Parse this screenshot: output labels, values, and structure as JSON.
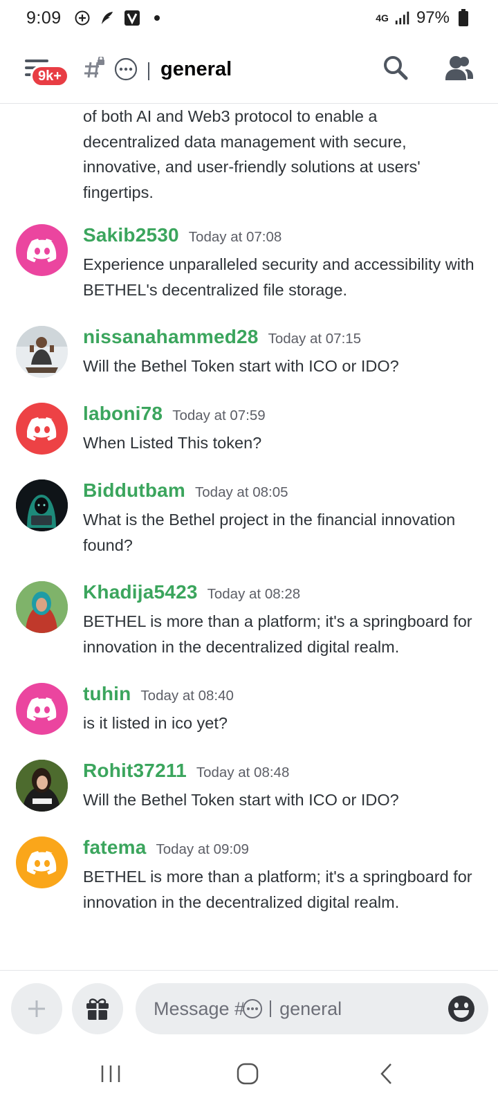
{
  "status_bar": {
    "time": "9:09",
    "network": "4G",
    "battery": "97%"
  },
  "header": {
    "badge": "9k+",
    "channel_name": "general"
  },
  "messages": {
    "continuation": "of both AI and Web3 protocol to enable a decentralized data management with secure, innovative, and user-friendly solutions at users' fingertips.",
    "items": [
      {
        "username": "Sakib2530",
        "timestamp": "Today at 07:08",
        "text": "Experience unparalleled security and accessibility with BETHEL's decentralized file storage.",
        "avatar": "discord-default-pink"
      },
      {
        "username": "nissanahammed28",
        "timestamp": "Today at 07:15",
        "text": "Will the Bethel Token start with ICO or IDO?",
        "avatar": "photo"
      },
      {
        "username": "laboni78",
        "timestamp": "Today at 07:59",
        "text": "When Listed This token?",
        "avatar": "discord-default-red"
      },
      {
        "username": "Biddutbam",
        "timestamp": "Today at 08:05",
        "text": "What is the Bethel project in the financial innovation found?",
        "avatar": "photo"
      },
      {
        "username": "Khadija5423",
        "timestamp": "Today at 08:28",
        "text": "BETHEL is more than a platform; it's a springboard for innovation in the decentralized digital realm.",
        "avatar": "photo"
      },
      {
        "username": "tuhin",
        "timestamp": "Today at 08:40",
        "text": "is it listed in ico yet?",
        "avatar": "discord-default-pink"
      },
      {
        "username": "Rohit37211",
        "timestamp": "Today at 08:48",
        "text": "Will the Bethel Token start with ICO or IDO?",
        "avatar": "photo"
      },
      {
        "username": "fatema",
        "timestamp": "Today at 09:09",
        "text": "BETHEL is more than a platform; it's a springboard for innovation in the decentralized digital realm.",
        "avatar": "discord-default-orange"
      }
    ]
  },
  "composer": {
    "placeholder_prefix": "Message #",
    "placeholder_channel": "general"
  },
  "colors": {
    "username": "#3ba55d",
    "badge": "#e83d44",
    "discord_pink": "#eb459f",
    "discord_red": "#ed4245",
    "discord_orange": "#faa61a"
  }
}
